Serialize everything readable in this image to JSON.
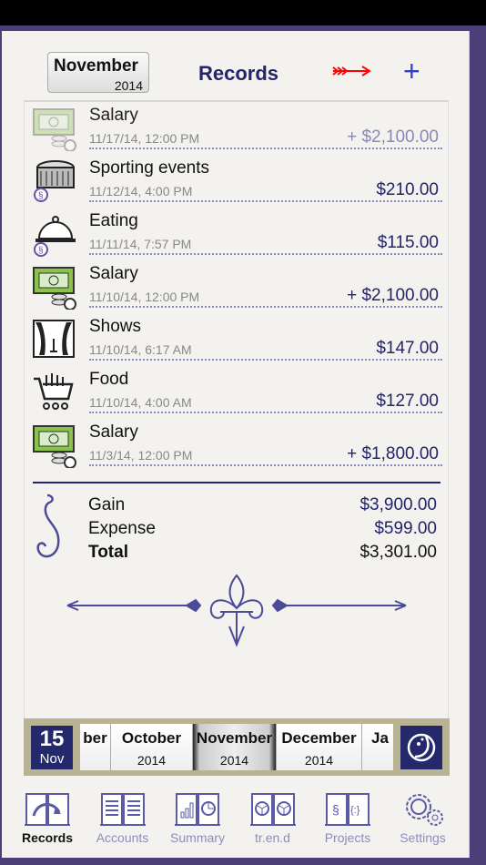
{
  "header": {
    "month": "November",
    "year": "2014",
    "title": "Records"
  },
  "records": [
    {
      "title": "Salary",
      "date": "11/17/14, 12:00 PM",
      "amount": "+ $2,100.00",
      "icon": "salary-icon",
      "faded": true
    },
    {
      "title": "Sporting events",
      "date": "11/12/14, 4:00 PM",
      "amount": "$210.00",
      "icon": "stadium-icon"
    },
    {
      "title": "Eating",
      "date": "11/11/14, 7:57 PM",
      "amount": "$115.00",
      "icon": "dining-cloche-icon"
    },
    {
      "title": "Salary",
      "date": "11/10/14, 12:00 PM",
      "amount": "+ $2,100.00",
      "icon": "salary-icon"
    },
    {
      "title": "Shows",
      "date": "11/10/14, 6:17 AM",
      "amount": "$147.00",
      "icon": "theater-icon"
    },
    {
      "title": "Food",
      "date": "11/10/14, 4:00 AM",
      "amount": "$127.00",
      "icon": "shopping-cart-icon"
    },
    {
      "title": "Salary",
      "date": "11/3/14, 12:00 PM",
      "amount": "+ $1,800.00",
      "icon": "salary-icon"
    }
  ],
  "summary": {
    "gain_label": "Gain",
    "gain": "$3,900.00",
    "expense_label": "Expense",
    "expense": "$599.00",
    "total_label": "Total",
    "total": "$3,301.00"
  },
  "date_bar": {
    "day": "15",
    "day_month": "Nov",
    "months": [
      {
        "m": "ber",
        "y": ""
      },
      {
        "m": "October",
        "y": "2014"
      },
      {
        "m": "November",
        "y": "2014",
        "selected": true
      },
      {
        "m": "December",
        "y": "2014"
      },
      {
        "m": "Ja",
        "y": ""
      }
    ]
  },
  "tabs": [
    {
      "label": "Records",
      "active": true
    },
    {
      "label": "Accounts"
    },
    {
      "label": "Summary"
    },
    {
      "label": "tr.en.d"
    },
    {
      "label": "Projects"
    },
    {
      "label": "Settings"
    }
  ],
  "colors": {
    "accent": "#23246a",
    "add": "#2f3fd0",
    "arrow": "#ff0000",
    "tab_inactive": "#8d8cc0"
  }
}
